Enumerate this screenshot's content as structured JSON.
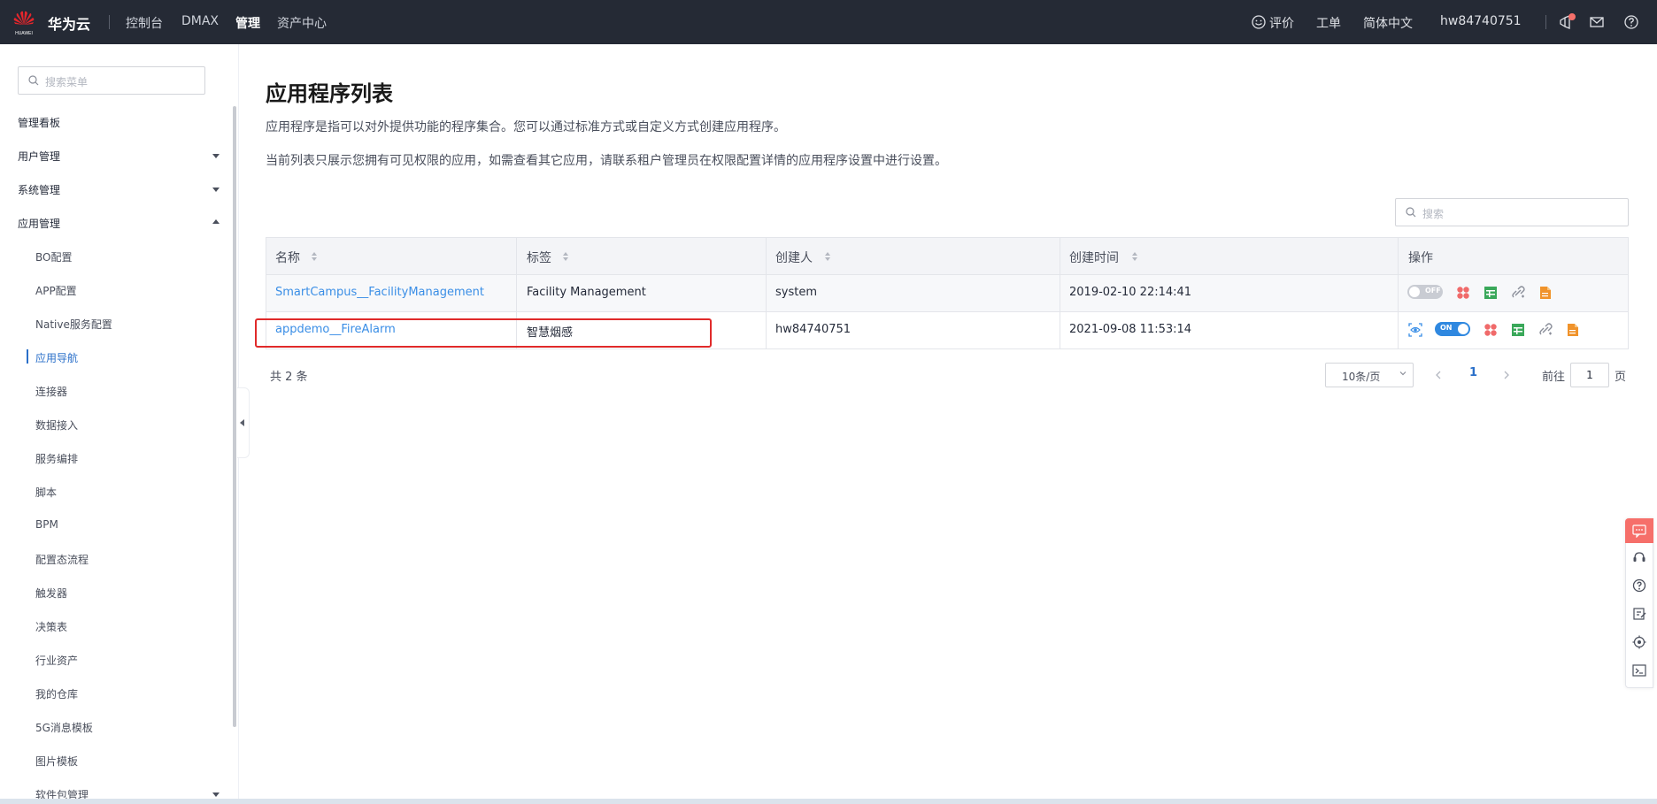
{
  "topbar": {
    "brand": "华为云",
    "logo_text": "HUAWEI",
    "nav": [
      "控制台",
      "DMAX",
      "管理",
      "资产中心"
    ],
    "active_nav": "管理",
    "feedback": "评价",
    "ticket": "工单",
    "language": "简体中文",
    "username": "hw84740751"
  },
  "sidebar": {
    "search_placeholder": "搜索菜单",
    "items": [
      {
        "label": "管理看板"
      },
      {
        "label": "用户管理"
      },
      {
        "label": "系统管理"
      },
      {
        "label": "应用管理"
      }
    ],
    "sub_items": [
      {
        "label": "BO配置"
      },
      {
        "label": "APP配置"
      },
      {
        "label": "Native服务配置"
      },
      {
        "label": "应用导航"
      },
      {
        "label": "连接器"
      },
      {
        "label": "数据接入"
      },
      {
        "label": "服务编排"
      },
      {
        "label": "脚本"
      },
      {
        "label": "BPM"
      },
      {
        "label": "配置态流程"
      },
      {
        "label": "触发器"
      },
      {
        "label": "决策表"
      },
      {
        "label": "行业资产"
      },
      {
        "label": "我的仓库"
      },
      {
        "label": "5G消息模板"
      },
      {
        "label": "图片模板"
      },
      {
        "label": "软件包管理"
      }
    ],
    "active_sub": "应用导航"
  },
  "main": {
    "title": "应用程序列表",
    "desc1": "应用程序是指可以对外提供功能的程序集合。您可以通过标准方式或自定义方式创建应用程序。",
    "desc2": "当前列表只展示您拥有可见权限的应用，如需查看其它应用，请联系租户管理员在权限配置详情的应用程序设置中进行设置。",
    "search_placeholder": "搜索",
    "columns": [
      "名称",
      "标签",
      "创建人",
      "创建时间",
      "操作"
    ],
    "rows": [
      {
        "name": "SmartCampus__FacilityManagement",
        "tag": "Facility Management",
        "creator": "system",
        "created": "2019-02-10 22:14:41",
        "toggle": "OFF"
      },
      {
        "name": "appdemo__FireAlarm",
        "tag": "智慧烟感",
        "creator": "hw84740751",
        "created": "2021-09-08 11:53:14",
        "toggle": "ON"
      }
    ],
    "total": "共 2 条",
    "page_size": "10条/页",
    "current_page": "1",
    "goto_label": "前往",
    "goto_value": "1",
    "goto_suffix": "页"
  },
  "colors": {
    "topbar_bg": "#252a35",
    "link": "#3a8ee6",
    "highlight_border": "#e02a2a",
    "toggle_on": "#2f88e0"
  }
}
